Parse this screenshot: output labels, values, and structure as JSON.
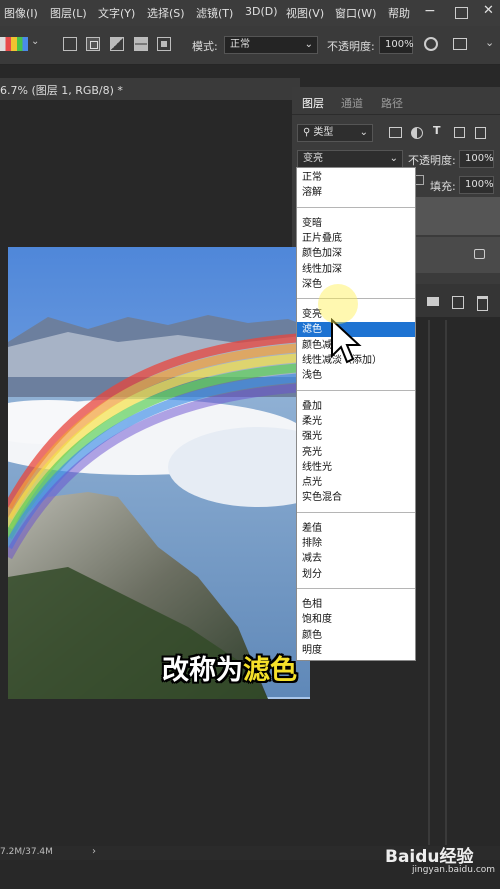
{
  "menu": [
    "图像(I)",
    "图层(L)",
    "文字(Y)",
    "选择(S)",
    "滤镜(T)",
    "3D(D)",
    "视图(V)",
    "窗口(W)",
    "帮助"
  ],
  "options_bar": {
    "mode_label": "模式:",
    "mode_value": "正常",
    "opacity_label": "不透明度:",
    "opacity_value": "100%"
  },
  "document_tab": "6.7% (图层 1, RGB/8) *",
  "layers_panel": {
    "tabs": [
      "图层",
      "通道",
      "路径"
    ],
    "filter_kind": "类型",
    "blend_mode_value": "变亮",
    "opacity_label": "不透明度:",
    "opacity_value": "100%",
    "fill_label": "填充:",
    "fill_value": "100%"
  },
  "blend_groups": [
    [
      "正常",
      "溶解"
    ],
    [
      "变暗",
      "正片叠底",
      "颜色加深",
      "线性加深",
      "深色"
    ],
    [
      "变亮",
      "滤色",
      "颜色减淡",
      "线性减淡（添加）",
      "浅色"
    ],
    [
      "叠加",
      "柔光",
      "强光",
      "亮光",
      "线性光",
      "点光",
      "实色混合"
    ],
    [
      "差值",
      "排除",
      "减去",
      "划分"
    ],
    [
      "色相",
      "饱和度",
      "颜色",
      "明度"
    ]
  ],
  "selected_blend": "滤色",
  "caption": {
    "prefix": "改称为",
    "highlight": "滤色"
  },
  "status_text": "7.2M/37.4M",
  "watermark": {
    "brand": "Baidu经验",
    "url": "jingyan.baidu.com"
  },
  "colors": {
    "selection": "#1e73d2",
    "caption_highlight": "#f5e02a"
  }
}
